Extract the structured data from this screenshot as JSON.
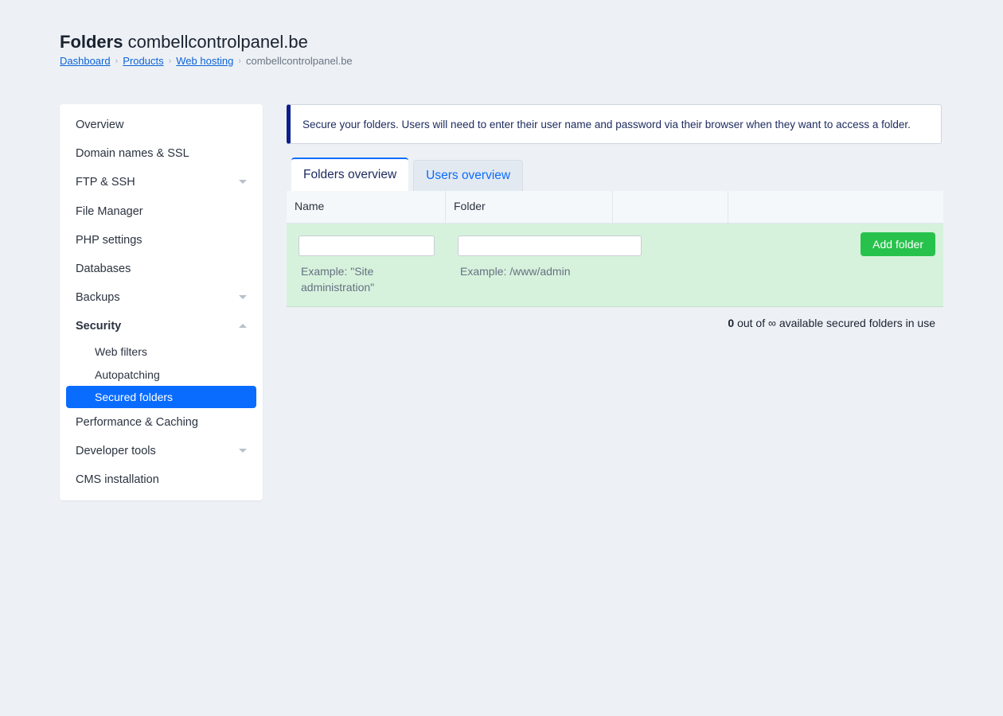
{
  "header": {
    "title_strong": "Folders",
    "title_domain": "combellcontrolpanel.be",
    "breadcrumb": [
      {
        "label": "Dashboard"
      },
      {
        "label": "Products"
      },
      {
        "label": "Web hosting"
      },
      {
        "label": "combellcontrolpanel.be"
      }
    ],
    "separator": "›"
  },
  "sidebar": {
    "items": [
      {
        "label": "Overview"
      },
      {
        "label": "Domain names & SSL"
      },
      {
        "label": "FTP & SSH"
      },
      {
        "label": "File Manager"
      },
      {
        "label": "PHP settings"
      },
      {
        "label": "Databases"
      },
      {
        "label": "Backups"
      },
      {
        "label": "Security"
      },
      {
        "label": "Performance & Caching"
      },
      {
        "label": "Developer tools"
      },
      {
        "label": "CMS installation"
      }
    ],
    "security_subitems": [
      {
        "label": "Web filters"
      },
      {
        "label": "Autopatching"
      },
      {
        "label": "Secured folders",
        "active": true
      }
    ],
    "active_color": "#0a6cff"
  },
  "notice": {
    "text": "Secure your folders. Users will need to enter their user name and password via their browser when they want to access a folder."
  },
  "tabs": [
    {
      "label": "Folders overview",
      "active": true
    },
    {
      "label": "Users overview",
      "active": false
    }
  ],
  "table": {
    "columns": [
      "Name",
      "Folder",
      "",
      ""
    ],
    "form": {
      "name_value": "",
      "folder_value": "",
      "name_hint": "Example: \"Site administration\"",
      "folder_hint": "Example: /www/admin",
      "add_button": "Add folder",
      "row_color": "#d6f2dd",
      "button_color": "#27c24c"
    }
  },
  "usage": {
    "count": "0",
    "out_of": "out of",
    "limit": "∞",
    "suffix": "available secured folders in use"
  }
}
